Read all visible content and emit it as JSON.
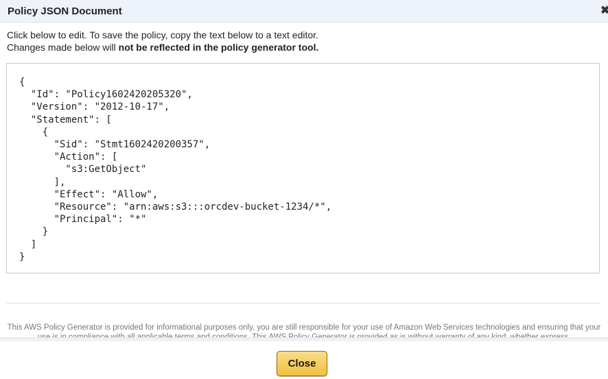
{
  "dialog": {
    "title": "Policy JSON Document",
    "close_icon": "close-x-icon",
    "close_glyph": "✖"
  },
  "instructions": {
    "line1": "Click below to edit. To save the policy, copy the text below to a text editor.",
    "line2_prefix": "Changes made below will ",
    "line2_bold": "not be reflected in the policy generator tool."
  },
  "policy_json": "{\n  \"Id\": \"Policy1602420205320\",\n  \"Version\": \"2012-10-17\",\n  \"Statement\": [\n    {\n      \"Sid\": \"Stmt1602420200357\",\n      \"Action\": [\n        \"s3:GetObject\"\n      ],\n      \"Effect\": \"Allow\",\n      \"Resource\": \"arn:aws:s3:::orcdev-bucket-1234/*\",\n      \"Principal\": \"*\"\n    }\n  ]\n}",
  "disclaimer": "This AWS Policy Generator is provided for informational purposes only, you are still responsible for your use of Amazon Web Services technologies and ensuring that your use is in compliance with all applicable terms and conditions. This AWS Policy Generator is provided as is without warranty of any kind, whether express,",
  "footer": {
    "close_label": "Close"
  }
}
